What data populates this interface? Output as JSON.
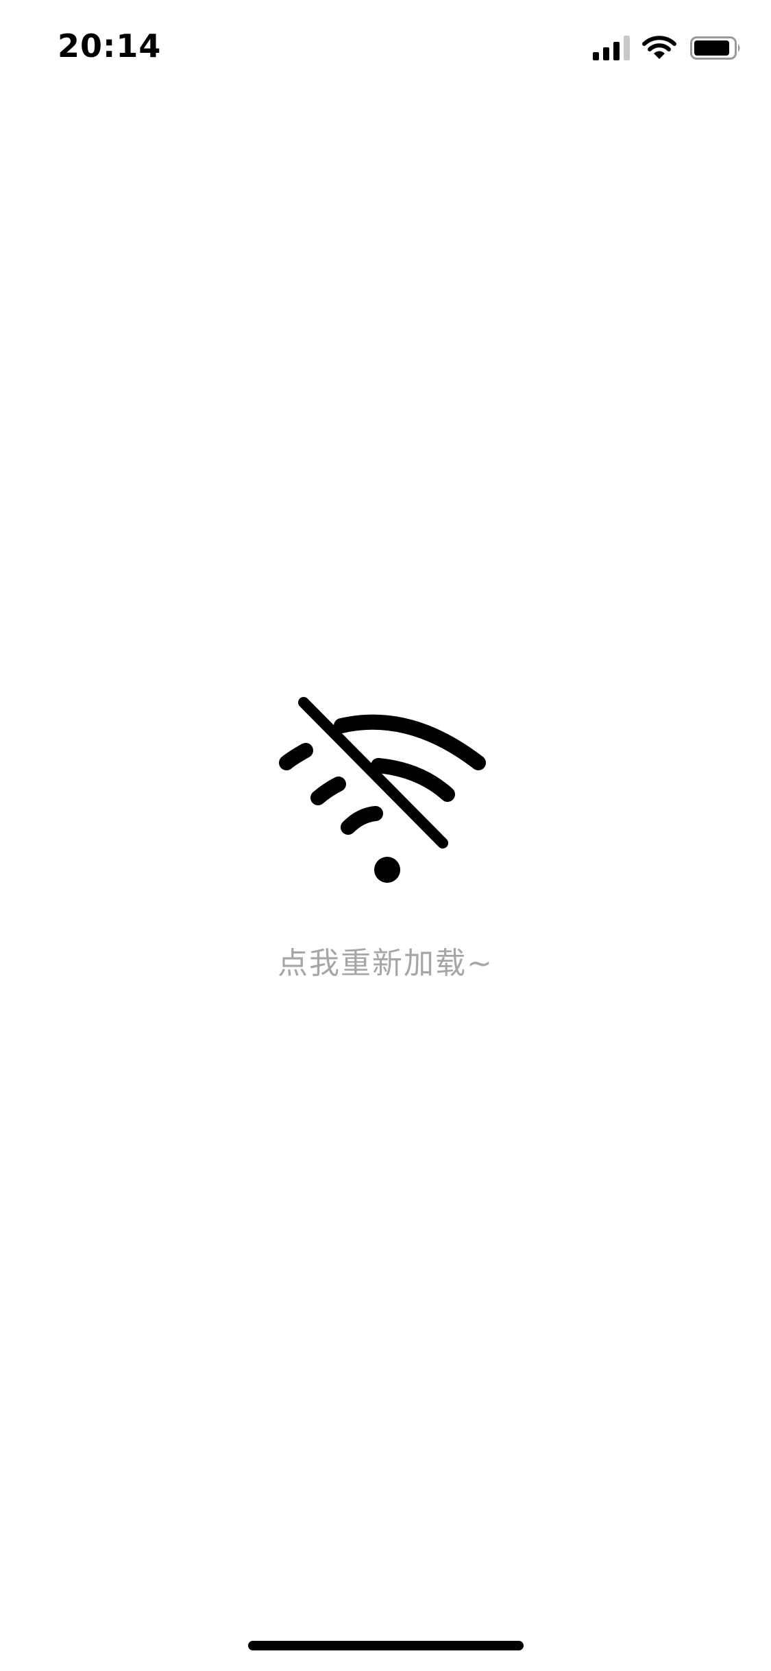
{
  "status_bar": {
    "time": "20:14",
    "signal_icon": "cellular-signal-icon",
    "wifi_icon": "wifi-icon",
    "battery_icon": "battery-icon"
  },
  "offline": {
    "icon": "wifi-off-icon",
    "reload_label": "点我重新加载~"
  },
  "colors": {
    "background": "#ffffff",
    "text_muted": "#a6a6a6",
    "icon": "#000000"
  }
}
